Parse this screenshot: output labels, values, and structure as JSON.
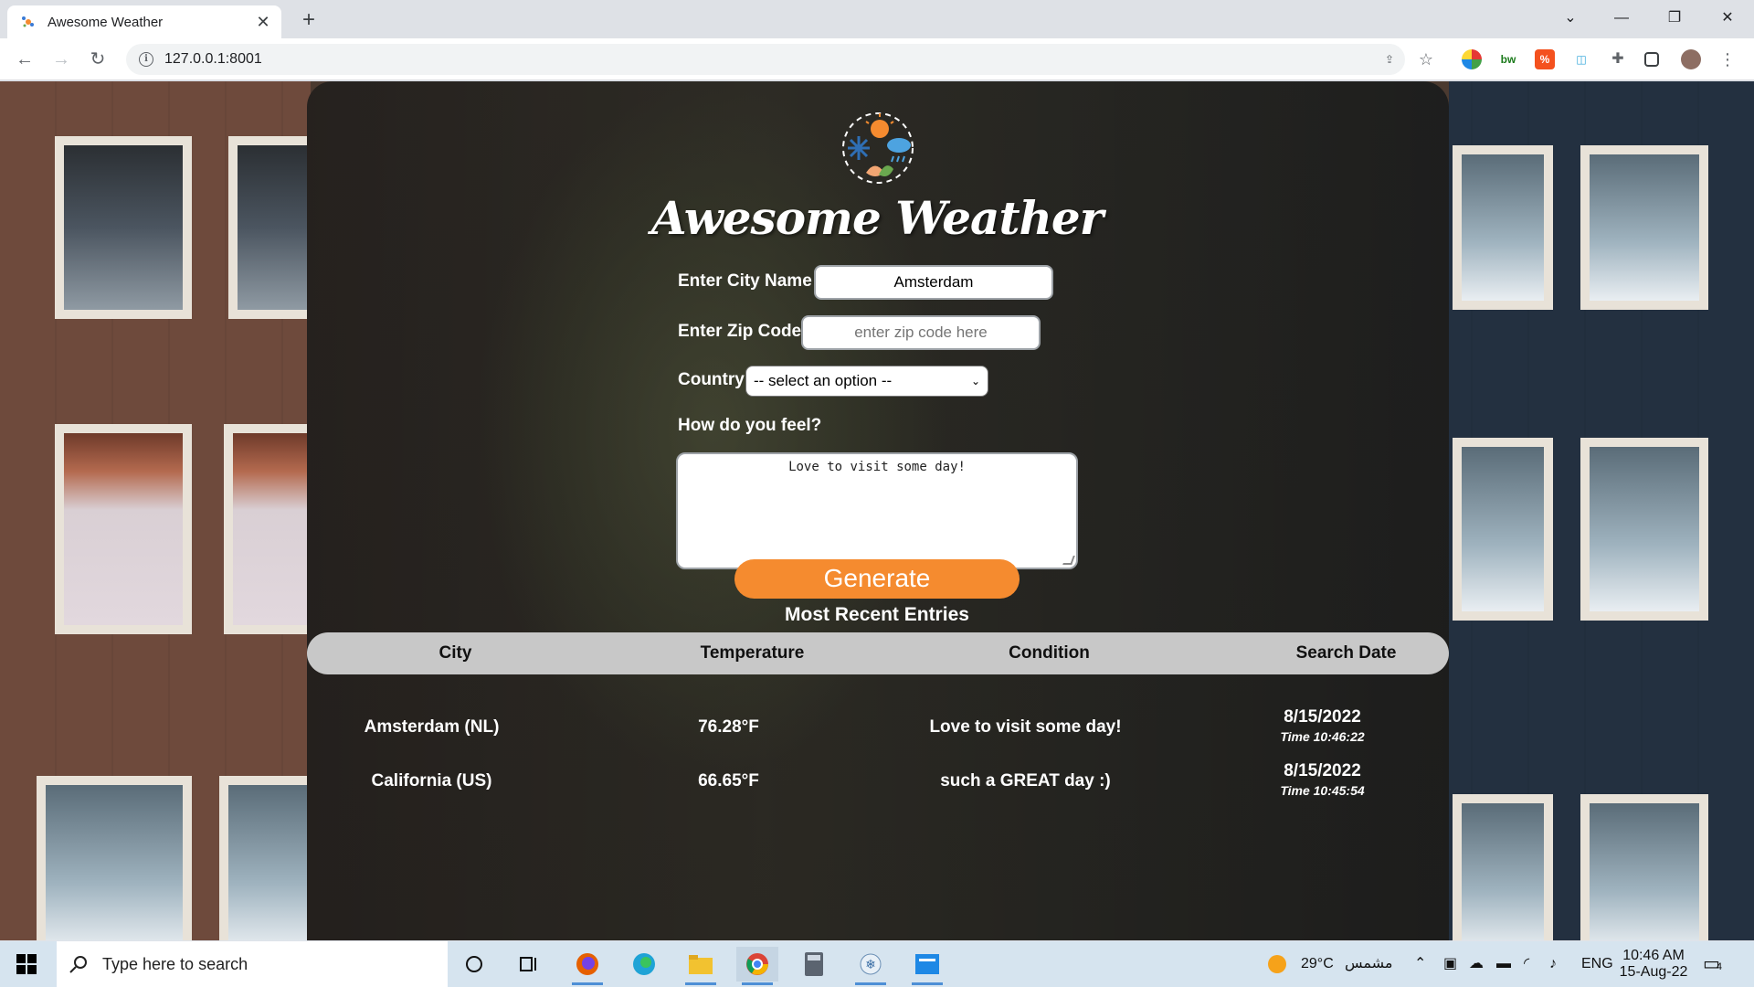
{
  "browser": {
    "tab_title": "Awesome Weather",
    "url": "127.0.0.1:8001"
  },
  "page": {
    "title": "Awesome Weather",
    "form": {
      "city_label": "Enter City Name",
      "city_value": "Amsterdam",
      "zip_label": "Enter Zip Code",
      "zip_placeholder": "enter zip code here",
      "country_label": "Country",
      "country_selected": "-- select an option --",
      "feel_label": "How do you feel?",
      "feel_value": "Love to visit some day!",
      "generate_label": "Generate"
    },
    "recent": {
      "title": "Most Recent Entries",
      "headers": [
        "City",
        "Temperature",
        "Condition",
        "Search Date"
      ],
      "rows": [
        {
          "city": "Amsterdam (NL)",
          "temperature": "76.28°F",
          "condition": "Love to visit some day!",
          "date": "8/15/2022",
          "time": "Time 10:46:22"
        },
        {
          "city": "California (US)",
          "temperature": "66.65°F",
          "condition": "such a GREAT day :)",
          "date": "8/15/2022",
          "time": "Time 10:45:54"
        }
      ]
    }
  },
  "taskbar": {
    "search_placeholder": "Type here to search",
    "weather_temp": "29°C",
    "weather_desc": "مشمس",
    "language": "ENG",
    "time": "10:46 AM",
    "date": "15-Aug-22",
    "notification_count": "4"
  },
  "colors": {
    "accent": "#f58b2f",
    "table_header": "#c8c8c8"
  }
}
